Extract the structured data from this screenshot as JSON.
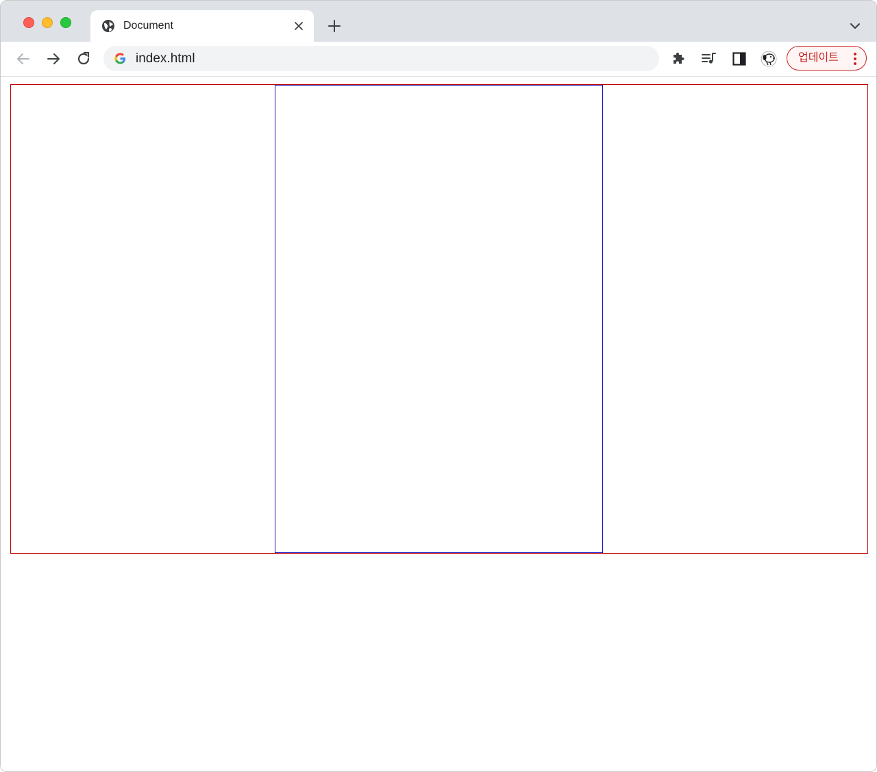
{
  "browser": {
    "tab": {
      "title": "Document",
      "favicon": "globe-icon"
    },
    "omnibox": {
      "url": "index.html",
      "engine_icon": "google-g-icon"
    },
    "toolbar": {
      "update_label": "업데이트"
    }
  },
  "page": {
    "outer_border_color": "#c00000",
    "inner_border_color": "#1010c0"
  }
}
